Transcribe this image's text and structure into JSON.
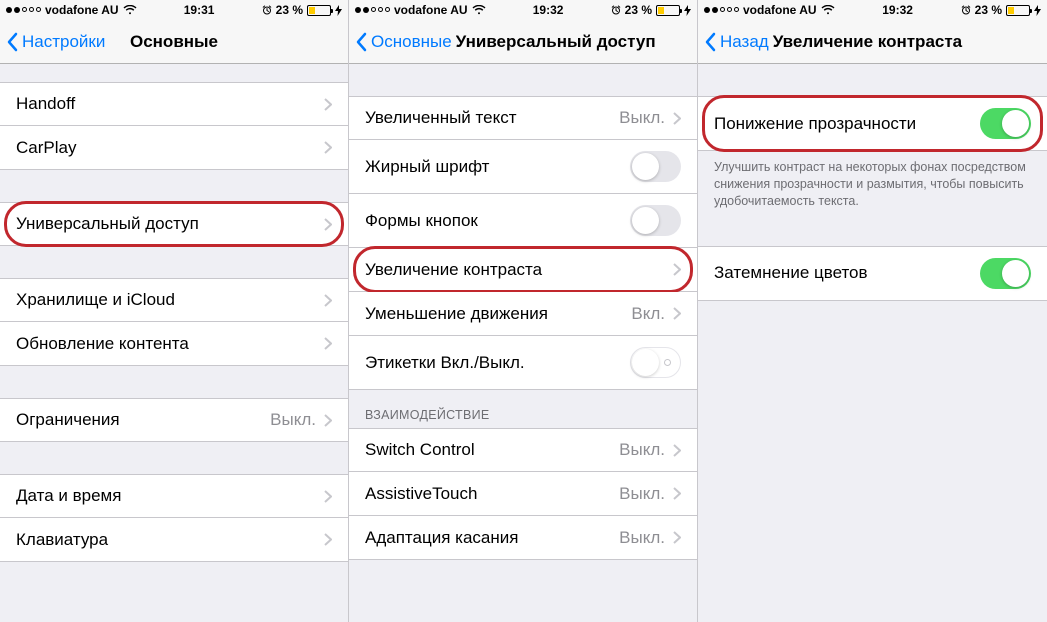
{
  "status": {
    "carrier": "vodafone AU",
    "battery_pct": "23 %"
  },
  "panes": [
    {
      "time": "19:31",
      "back": "Настройки",
      "title": "Основные",
      "highlight_index": 2,
      "groups": [
        {
          "top": true,
          "rows": [
            {
              "label": "Handoff",
              "disclosure": true
            },
            {
              "label": "CarPlay",
              "disclosure": true
            }
          ]
        },
        {
          "rows": [
            {
              "label": "Универсальный доступ",
              "disclosure": true
            }
          ]
        },
        {
          "rows": [
            {
              "label": "Хранилище и iCloud",
              "disclosure": true
            },
            {
              "label": "Обновление контента",
              "disclosure": true
            }
          ]
        },
        {
          "rows": [
            {
              "label": "Ограничения",
              "detail": "Выкл.",
              "disclosure": true
            }
          ]
        },
        {
          "rows": [
            {
              "label": "Дата и время",
              "disclosure": true
            },
            {
              "label": "Клавиатура",
              "disclosure": true
            }
          ]
        }
      ]
    },
    {
      "time": "19:32",
      "back": "Основные",
      "title": "Универсальный доступ",
      "tight": true,
      "highlight_index": 3,
      "groups": [
        {
          "gap": true,
          "rows": [
            {
              "label": "Увеличенный текст",
              "detail": "Выкл.",
              "disclosure": true
            },
            {
              "label": "Жирный шрифт",
              "switch": "off"
            },
            {
              "label": "Формы кнопок",
              "switch": "off"
            },
            {
              "label": "Увеличение контраста",
              "disclosure": true
            },
            {
              "label": "Уменьшение движения",
              "detail": "Вкл.",
              "disclosure": true
            },
            {
              "label": "Этикетки Вкл./Выкл.",
              "switch": "off-outline-dot"
            }
          ]
        },
        {
          "header": "ВЗАИМОДЕЙСТВИЕ",
          "rows": [
            {
              "label": "Switch Control",
              "detail": "Выкл.",
              "disclosure": true
            },
            {
              "label": "AssistiveTouch",
              "detail": "Выкл.",
              "disclosure": true
            },
            {
              "label": "Адаптация касания",
              "detail": "Выкл.",
              "disclosure": true
            }
          ]
        }
      ]
    },
    {
      "time": "19:32",
      "back": "Назад",
      "title": "Увеличение контраста",
      "tight": true,
      "highlight_index": 0,
      "groups": [
        {
          "gap": true,
          "rows": [
            {
              "label": "Понижение прозрачности",
              "switch": "on"
            }
          ],
          "footer": "Улучшить контраст на некоторых фонах посредством снижения прозрачности и размытия, чтобы повысить удобочитаемость текста."
        },
        {
          "rows": [
            {
              "label": "Затемнение цветов",
              "switch": "on"
            }
          ]
        }
      ]
    }
  ]
}
